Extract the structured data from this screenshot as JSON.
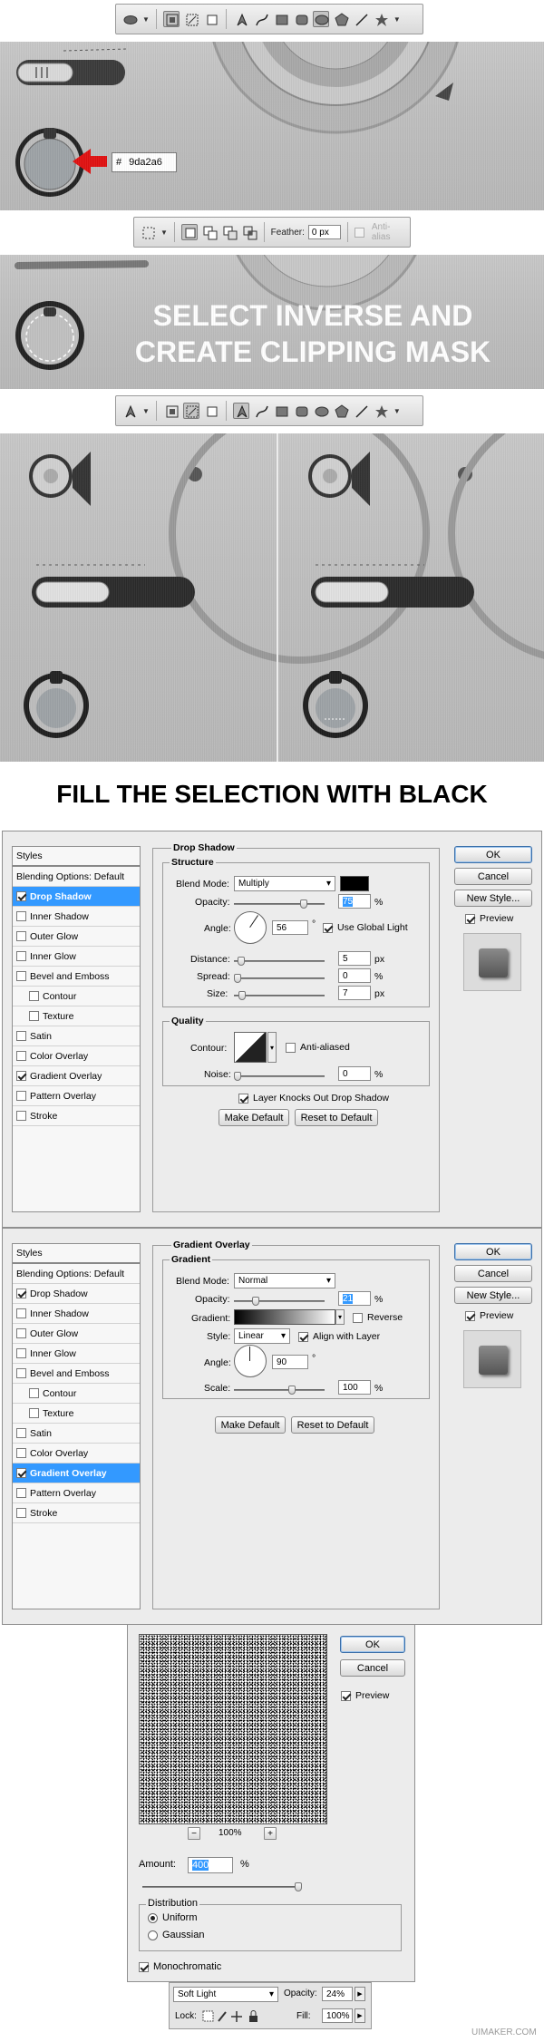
{
  "toolbar1": {
    "tools": [
      "ellipse-shape",
      "path-mode",
      "pen",
      "freeform-pen",
      "rectangle",
      "rounded-rectangle",
      "ellipse",
      "polygon",
      "line",
      "custom-shape"
    ]
  },
  "panel1": {
    "hex_prefix": "#",
    "hex_value": "9da2a6",
    "accent": "#9da2a6",
    "arrow_color": "#e01010"
  },
  "toolbar2": {
    "feather_label": "Feather:",
    "feather_value": "0 px",
    "antialias_label": "Anti-alias"
  },
  "panel2": {
    "headline_line1": "SELECT INVERSE AND",
    "headline_line2": "CREATE CLIPPING MASK"
  },
  "toolbar3": {
    "tools": [
      "pen",
      "shape-layers",
      "paths",
      "fill-pixels",
      "pen",
      "freeform-pen",
      "rectangle",
      "rounded-rectangle",
      "ellipse",
      "polygon",
      "line",
      "custom-shape"
    ]
  },
  "heading": "FILL THE SELECTION WITH BLACK",
  "layer_styles": [
    "Styles",
    "Blending Options: Default",
    "Drop Shadow",
    "Inner Shadow",
    "Outer Glow",
    "Inner Glow",
    "Bevel and Emboss",
    "Contour",
    "Texture",
    "Satin",
    "Color Overlay",
    "Gradient Overlay",
    "Pattern Overlay",
    "Stroke"
  ],
  "dialog1": {
    "section": "Drop Shadow",
    "group_structure": "Structure",
    "blend_mode_label": "Blend Mode:",
    "blend_mode": "Multiply",
    "opacity_label": "Opacity:",
    "opacity": "75",
    "pct": "%",
    "angle_label": "Angle:",
    "angle": "56",
    "deg": "°",
    "use_global_light": "Use Global Light",
    "distance_label": "Distance:",
    "distance": "5",
    "spread_label": "Spread:",
    "spread": "0",
    "size_label": "Size:",
    "size": "7",
    "px": "px",
    "group_quality": "Quality",
    "contour_label": "Contour:",
    "antialiased": "Anti-aliased",
    "noise_label": "Noise:",
    "noise": "0",
    "knockout": "Layer Knocks Out Drop Shadow",
    "make_default": "Make Default",
    "reset_default": "Reset to Default",
    "ok": "OK",
    "cancel": "Cancel",
    "new_style": "New Style...",
    "preview": "Preview"
  },
  "dialog2": {
    "section": "Gradient Overlay",
    "group_gradient": "Gradient",
    "blend_mode_label": "Blend Mode:",
    "blend_mode": "Normal",
    "opacity_label": "Opacity:",
    "opacity": "21",
    "pct": "%",
    "gradient_label": "Gradient:",
    "reverse": "Reverse",
    "style_label": "Style:",
    "style": "Linear",
    "align_layer": "Align with Layer",
    "angle_label": "Angle:",
    "angle": "90",
    "deg": "°",
    "scale_label": "Scale:",
    "scale": "100",
    "make_default": "Make Default",
    "reset_default": "Reset to Default",
    "ok": "OK",
    "cancel": "Cancel",
    "new_style": "New Style...",
    "preview": "Preview"
  },
  "noise_dialog": {
    "ok": "OK",
    "cancel": "Cancel",
    "preview": "Preview",
    "zoom_minus": "−",
    "zoom": "100%",
    "zoom_plus": "+",
    "amount_label": "Amount:",
    "amount": "400",
    "pct": "%",
    "distribution": "Distribution",
    "uniform": "Uniform",
    "gaussian": "Gaussian",
    "monochromatic": "Monochromatic"
  },
  "layers_bar": {
    "blend": "Soft Light",
    "opacity_label": "Opacity:",
    "opacity": "24%",
    "lock_label": "Lock:",
    "fill_label": "Fill:",
    "fill": "100%"
  },
  "watermark": "UIMAKER.COM"
}
